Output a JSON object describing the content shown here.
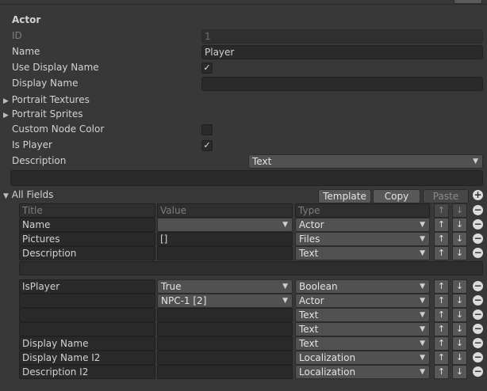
{
  "section_title": "Actor",
  "id_field": {
    "label": "ID",
    "value": "1"
  },
  "name_field": {
    "label": "Name",
    "value": "Player"
  },
  "use_display_name": {
    "label": "Use Display Name",
    "checked": true,
    "mark": "✓"
  },
  "display_name": {
    "label": "Display Name",
    "value": ""
  },
  "portrait_textures": {
    "label": "Portrait Textures"
  },
  "portrait_sprites": {
    "label": "Portrait Sprites"
  },
  "custom_node_color": {
    "label": "Custom Node Color",
    "checked": false,
    "mark": ""
  },
  "is_player": {
    "label": "Is Player",
    "checked": true,
    "mark": "✓"
  },
  "description": {
    "label": "Description",
    "type_value": "Text",
    "value": ""
  },
  "all_fields": {
    "label": "All Fields",
    "buttons": {
      "template": "Template",
      "copy": "Copy",
      "paste": "Paste"
    },
    "add_icon": "plus-circle-icon",
    "headers": {
      "title": "Title",
      "value": "Value",
      "type": "Type"
    },
    "rows_group1": [
      {
        "title": "Name",
        "value": "",
        "value_kind": "dropdown",
        "type": "Actor"
      },
      {
        "title": "Pictures",
        "value": "[]",
        "value_kind": "text",
        "type": "Files"
      },
      {
        "title": "Description",
        "value": "",
        "value_kind": "text",
        "type": "Text"
      }
    ],
    "rows_group2": [
      {
        "title": "IsPlayer",
        "value": "True",
        "value_kind": "dropdown",
        "type": "Boolean"
      },
      {
        "title": "",
        "value": "NPC-1 [2]",
        "value_kind": "dropdown",
        "type": "Actor"
      },
      {
        "title": "",
        "value": "",
        "value_kind": "text",
        "type": "Text"
      },
      {
        "title": "",
        "value": "",
        "value_kind": "text",
        "type": "Text"
      },
      {
        "title": "Display Name",
        "value": "",
        "value_kind": "text",
        "type": "Text"
      },
      {
        "title": "Display Name I2",
        "value": "",
        "value_kind": "text",
        "type": "Localization"
      },
      {
        "title": "Description I2",
        "value": "",
        "value_kind": "text",
        "type": "Localization"
      }
    ],
    "move_up": "↑",
    "move_down": "↓",
    "remove": "−"
  },
  "colors": {
    "background": "#383838",
    "field": "#2a2a2a",
    "button": "#585858",
    "text": "#d2d2d2"
  }
}
